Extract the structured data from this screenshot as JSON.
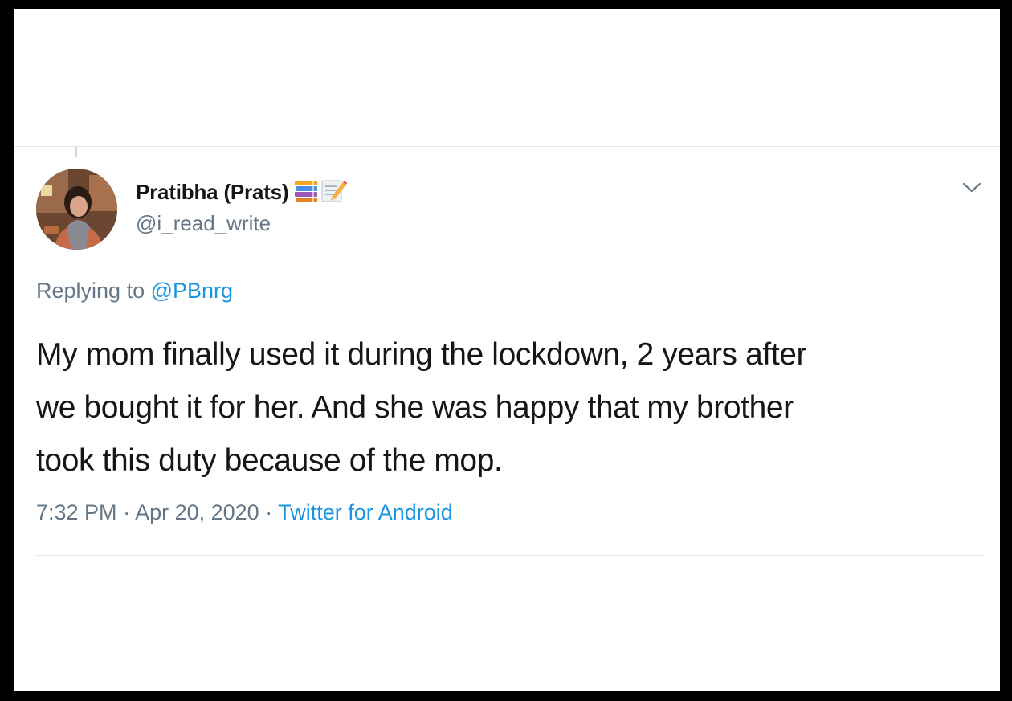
{
  "author": {
    "display_name": "Pratibha (Prats)",
    "emoji": [
      "books-emoji",
      "memo-emoji"
    ],
    "handle": "@i_read_write"
  },
  "reply": {
    "prefix": "Replying to",
    "mention": "@PBnrg"
  },
  "tweet": {
    "lines": [
      "My mom finally used it during the lockdown, 2 years after",
      "we bought it for her. And she was happy that my brother",
      "took this duty because of the mop."
    ]
  },
  "meta": {
    "time": "7:32 PM",
    "separator": " · ",
    "date": "Apr 20, 2020",
    "source": "Twitter for Android"
  },
  "colors": {
    "text_primary": "#14171a",
    "text_secondary": "#657786",
    "link": "#1b95e0",
    "divider": "#e1e8ed"
  },
  "icons": {
    "menu": "chevron-down-icon"
  }
}
